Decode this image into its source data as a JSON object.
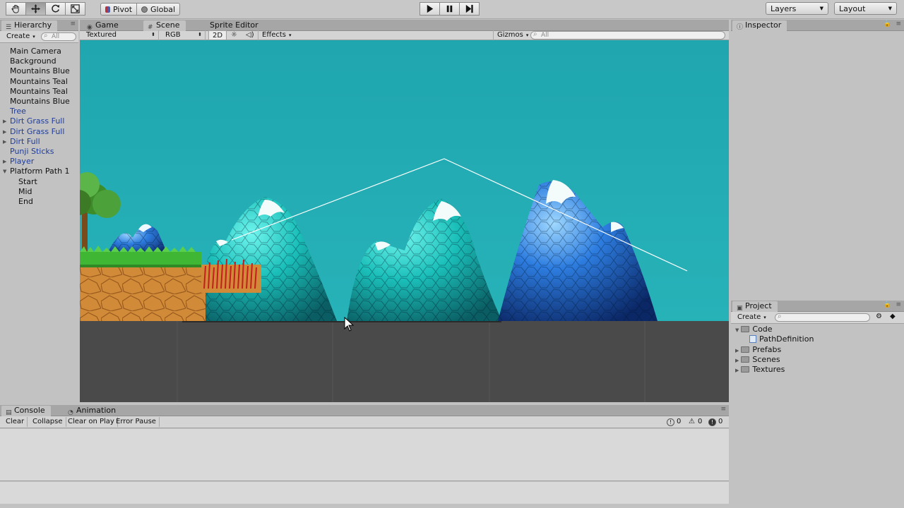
{
  "toolbar": {
    "pivot_label": "Pivot",
    "global_label": "Global",
    "layers_label": "Layers",
    "layout_label": "Layout"
  },
  "hierarchy": {
    "tab_label": "Hierarchy",
    "create_label": "Create",
    "search_placeholder": "All",
    "items": [
      {
        "label": "Main Camera",
        "prefab": false,
        "expandable": false,
        "indent": 0
      },
      {
        "label": "Background",
        "prefab": false,
        "expandable": false,
        "indent": 0
      },
      {
        "label": "Mountains Blue",
        "prefab": false,
        "expandable": false,
        "indent": 0
      },
      {
        "label": "Mountains Teal",
        "prefab": false,
        "expandable": false,
        "indent": 0
      },
      {
        "label": "Mountains Teal",
        "prefab": false,
        "expandable": false,
        "indent": 0
      },
      {
        "label": "Mountains Blue",
        "prefab": false,
        "expandable": false,
        "indent": 0
      },
      {
        "label": "Tree",
        "prefab": true,
        "expandable": false,
        "indent": 0
      },
      {
        "label": "Dirt Grass Full",
        "prefab": true,
        "expandable": true,
        "indent": 0
      },
      {
        "label": "Dirt Grass Full",
        "prefab": true,
        "expandable": true,
        "indent": 0
      },
      {
        "label": "Dirt Full",
        "prefab": true,
        "expandable": true,
        "indent": 0
      },
      {
        "label": "Punji Sticks",
        "prefab": true,
        "expandable": false,
        "indent": 0
      },
      {
        "label": "Player",
        "prefab": true,
        "expandable": true,
        "indent": 0
      },
      {
        "label": "Platform Path 1",
        "prefab": false,
        "expandable": true,
        "expanded": true,
        "indent": 0
      },
      {
        "label": "Start",
        "prefab": false,
        "expandable": false,
        "indent": 1
      },
      {
        "label": "Mid",
        "prefab": false,
        "expandable": false,
        "indent": 1
      },
      {
        "label": "End",
        "prefab": false,
        "expandable": false,
        "indent": 1
      }
    ]
  },
  "scene": {
    "tabs": [
      {
        "label": "Game",
        "icon": "game-icon",
        "active": false
      },
      {
        "label": "Scene",
        "icon": "scene-icon",
        "active": true
      },
      {
        "label": "Sprite Editor",
        "icon": "",
        "active": false
      }
    ],
    "render_mode": "Textured",
    "color_mode": "RGB",
    "mode_2d": "2D",
    "effects_label": "Effects",
    "gizmos_label": "Gizmos",
    "search_placeholder": "All",
    "colors": {
      "sky": "#22a6b0",
      "ground": "#4a4a4a",
      "teal": "#1fc7c2",
      "blue": "#1e5fd0",
      "dirt": "#d08a38",
      "grass": "#47c53a"
    }
  },
  "inspector": {
    "tab_label": "Inspector"
  },
  "project": {
    "tab_label": "Project",
    "create_label": "Create",
    "items": [
      {
        "label": "Code",
        "type": "folder",
        "expanded": true,
        "indent": 0
      },
      {
        "label": "PathDefinition",
        "type": "script",
        "indent": 1
      },
      {
        "label": "Prefabs",
        "type": "folder",
        "expanded": false,
        "indent": 0
      },
      {
        "label": "Scenes",
        "type": "folder",
        "expanded": false,
        "indent": 0
      },
      {
        "label": "Textures",
        "type": "folder",
        "expanded": false,
        "indent": 0
      }
    ]
  },
  "console": {
    "tabs": [
      {
        "label": "Console",
        "icon": "console-icon",
        "active": true
      },
      {
        "label": "Animation",
        "icon": "animation-icon",
        "active": false
      }
    ],
    "buttons": [
      "Clear",
      "Collapse",
      "Clear on Play",
      "Error Pause"
    ],
    "log_count": "0",
    "warning_count": "0",
    "error_count": "0"
  }
}
